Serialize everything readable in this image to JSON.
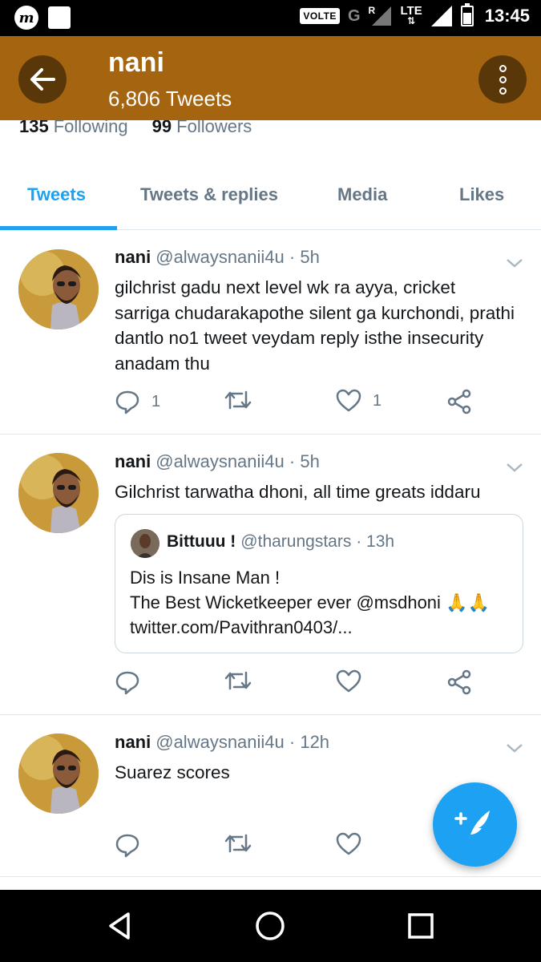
{
  "status_bar": {
    "volte": "VOLTE",
    "network_g": "G",
    "roaming": "R",
    "lte": "LTE",
    "time": "13:45"
  },
  "header": {
    "name": "nani",
    "tweet_count": "6,806 Tweets"
  },
  "profile": {
    "following_count": "135",
    "following_label": "Following",
    "followers_count": "99",
    "followers_label": "Followers"
  },
  "tabs": [
    {
      "label": "Tweets",
      "active": true
    },
    {
      "label": "Tweets & replies",
      "active": false
    },
    {
      "label": "Media",
      "active": false
    },
    {
      "label": "Likes",
      "active": false
    }
  ],
  "tweets": [
    {
      "name": "nani",
      "handle": "@alwaysnanii4u",
      "time": "· 5h",
      "text": "gilchrist gadu next level wk ra ayya, cricket sarriga chudarakapothe silent ga kurchondi, prathi dantlo no1 tweet veydam reply isthe insecurity anadam thu",
      "reply_count": "1",
      "like_count": "1"
    },
    {
      "name": "nani",
      "handle": "@alwaysnanii4u",
      "time": "· 5h",
      "text": "Gilchrist tarwatha dhoni, all time greats iddaru",
      "quote": {
        "name": "Bittuuu !",
        "handle": "@tharungstars",
        "time": "· 13h",
        "line1": "Dis is Insane Man !",
        "line2": "The Best Wicketkeeper ever @msdhoni 🙏🙏",
        "line3": "twitter.com/Pavithran0403/..."
      }
    },
    {
      "name": "nani",
      "handle": "@alwaysnanii4u",
      "time": "· 12h",
      "text": "Suarez scores"
    }
  ],
  "colors": {
    "header_bg": "#a5640f",
    "accent": "#1da1f2",
    "secondary_text": "#657786"
  }
}
